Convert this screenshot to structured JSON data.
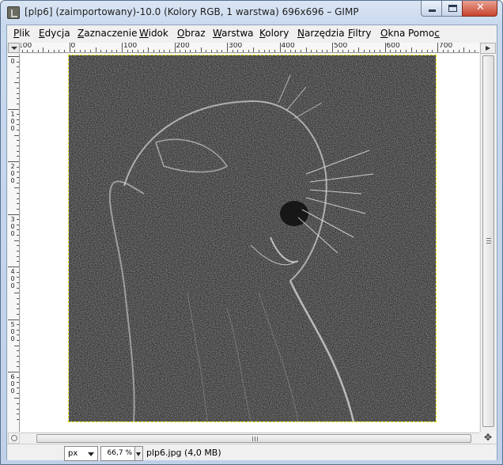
{
  "window": {
    "title": "[plp6] (zaimportowany)-10.0 (Kolory RGB, 1 warstwa) 696x696 – GIMP",
    "minimize_glyph": "",
    "close_glyph": "✕"
  },
  "menubar": {
    "items": [
      {
        "label": "Plik",
        "mnemonic": "P"
      },
      {
        "label": "Edycja",
        "mnemonic": "E"
      },
      {
        "label": "Zaznaczenie",
        "mnemonic": "Z"
      },
      {
        "label": "Widok",
        "mnemonic": "W"
      },
      {
        "label": "Obraz",
        "mnemonic": "O"
      },
      {
        "label": "Warstwa",
        "mnemonic": "W"
      },
      {
        "label": "Kolory",
        "mnemonic": "K"
      },
      {
        "label": "Narzędzia",
        "mnemonic": "N"
      },
      {
        "label": "Filtry",
        "mnemonic": "F"
      },
      {
        "label": "Okna",
        "mnemonic": "O"
      },
      {
        "label": "Pomoc",
        "mnemonic": "c"
      }
    ]
  },
  "ruler_horizontal": {
    "labels": [
      "100",
      "0",
      "100",
      "200",
      "300",
      "400",
      "500",
      "600",
      "700"
    ]
  },
  "ruler_vertical": {
    "labels": [
      "0",
      "100",
      "200",
      "300",
      "400",
      "500",
      "600"
    ]
  },
  "canvas": {
    "image_description_icon": "photo-canvas",
    "colors": {
      "background": "#2e2e2e",
      "selection_border": "#e6e600"
    }
  },
  "statusbar": {
    "unit": "px",
    "zoom": "66,7 %",
    "info": "plp6.jpg (4,0 MB)"
  },
  "icons": {
    "corner": "quick-mask-menu-icon",
    "navigate": "navigate-icon",
    "zoom": "zoom-icon",
    "move": "move-icon"
  }
}
